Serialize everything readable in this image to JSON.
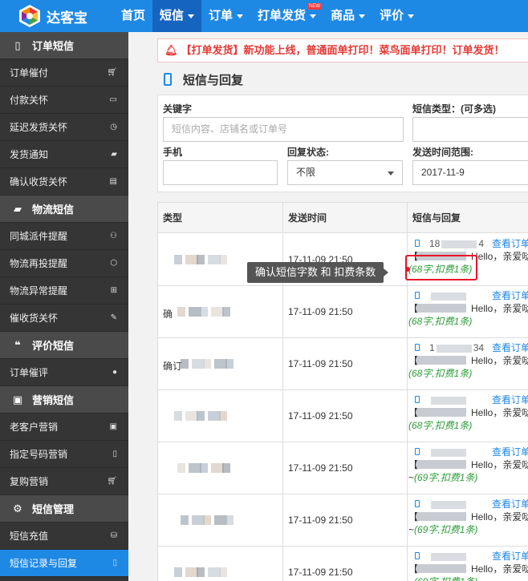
{
  "app": {
    "name": "达客宝"
  },
  "nav": [
    {
      "label": "首页",
      "active": false,
      "dropdown": false
    },
    {
      "label": "短信",
      "active": true,
      "dropdown": true
    },
    {
      "label": "订单",
      "active": false,
      "dropdown": true
    },
    {
      "label": "打单发货",
      "active": false,
      "dropdown": true,
      "badge": "NEW"
    },
    {
      "label": "商品",
      "active": false,
      "dropdown": true
    },
    {
      "label": "评价",
      "active": false,
      "dropdown": true
    }
  ],
  "sidebar": {
    "groups": [
      {
        "label": "订单短信",
        "icon": "mobile-icon",
        "items": [
          {
            "label": "订单催付",
            "icon": "cart-icon"
          },
          {
            "label": "付款关怀",
            "icon": "card-icon"
          },
          {
            "label": "延迟发货关怀",
            "icon": "clock-icon"
          },
          {
            "label": "发货通知",
            "icon": "truck-icon"
          },
          {
            "label": "确认收货关怀",
            "icon": "box-icon"
          }
        ]
      },
      {
        "label": "物流短信",
        "icon": "truck-icon",
        "items": [
          {
            "label": "同城派件提醒",
            "icon": "motorcycle-icon"
          },
          {
            "label": "物流再投提醒",
            "icon": "cube-icon"
          },
          {
            "label": "物流异常提醒",
            "icon": "ambulance-icon"
          },
          {
            "label": "催收货关怀",
            "icon": "pencil-icon"
          }
        ]
      },
      {
        "label": "评价短信",
        "icon": "comments-icon",
        "items": [
          {
            "label": "订单催评",
            "icon": "comment-icon"
          }
        ]
      },
      {
        "label": "营销短信",
        "icon": "gift-icon",
        "items": [
          {
            "label": "老客户营销",
            "icon": "gift-icon"
          },
          {
            "label": "指定号码营销",
            "icon": "mobile-icon"
          },
          {
            "label": "复购营销",
            "icon": "cart-icon"
          }
        ]
      },
      {
        "label": "短信管理",
        "icon": "gear-icon",
        "items": [
          {
            "label": "短信充值",
            "icon": "coins-icon"
          },
          {
            "label": "短信记录与回复",
            "icon": "mobile-icon",
            "active": true
          }
        ]
      }
    ]
  },
  "notice": {
    "text": "【打单发货】新功能上线，普通面单打印！菜鸟面单打印！订单发货！"
  },
  "page": {
    "title": "短信与回复"
  },
  "filters": {
    "keyword_label": "关键字",
    "keyword_placeholder": "短信内容、店铺名或订单号",
    "sms_type_label": "短信类型：(可多选)",
    "phone_label": "手机",
    "reply_status_label": "回复状态:",
    "reply_status_value": "不限",
    "send_time_label": "发送时间范围:",
    "send_time_value": "2017-11-9"
  },
  "table": {
    "columns": [
      "类型",
      "发送时间",
      "短信与回复"
    ],
    "view_label": "查看订单",
    "rows": [
      {
        "type_prefix": "",
        "time": "17-11-09 21:50",
        "num_prefix": "18",
        "num_suffix": "4",
        "brand_prefix": "【",
        "hello": "Hello，亲爱哒",
        "cost": "(68字,扣费1条)"
      },
      {
        "type_prefix": "确",
        "time": "17-11-09 21:50",
        "num_prefix": "",
        "num_suffix": "",
        "brand_prefix": "【",
        "hello": "Hello，亲爱哒",
        "cost": "(68字,扣费1条)"
      },
      {
        "type_prefix": "确订",
        "time": "17-11-09 21:50",
        "num_prefix": "1",
        "num_suffix": "34",
        "brand_prefix": "【",
        "hello": "Hello，亲爱哒",
        "cost": "(68字,扣费1条)"
      },
      {
        "type_prefix": "",
        "time": "17-11-09 21:50",
        "num_prefix": "",
        "num_suffix": "",
        "brand_prefix": "【",
        "hello": "Hello，亲爱哒",
        "cost": "(68字,扣费1条)"
      },
      {
        "type_prefix": "",
        "time": "17-11-09 21:50",
        "num_prefix": "",
        "num_suffix": "",
        "brand_prefix": "【",
        "hello": "Hello，亲爱哒",
        "cost": "(69字,扣费1条)",
        "tilde": "~"
      },
      {
        "type_prefix": "",
        "time": "17-11-09 21:50",
        "num_prefix": "",
        "num_suffix": "",
        "brand_prefix": "【",
        "hello": "Hello，亲爱哒",
        "cost": "(69字,扣费1条)",
        "tilde": "~"
      },
      {
        "type_prefix": "",
        "time": "17-11-09 21:50",
        "num_prefix": "",
        "num_suffix": "",
        "brand_prefix": "【",
        "hello": "Hello，亲爱哒",
        "cost": "(69字,扣费1条)",
        "tilde": "~"
      }
    ]
  },
  "tooltip": {
    "text": "确认短信字数 和 扣费条数"
  },
  "colors": {
    "primary": "#1e88e5",
    "primary_dark": "#1565c0",
    "sidebar": "#353535",
    "sidebar_group": "#4a4a4a",
    "alert": "#e53935",
    "cost_green": "#2e9d3a"
  }
}
